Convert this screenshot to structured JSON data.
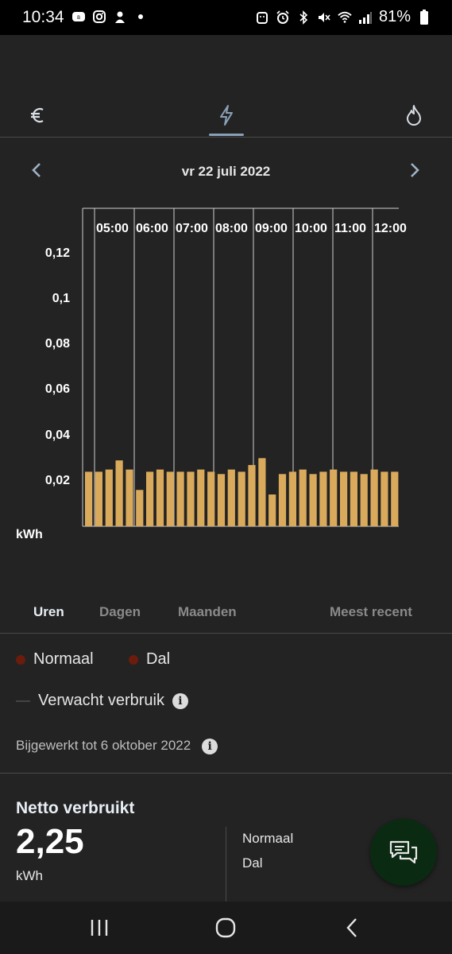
{
  "status_bar": {
    "time": "10:34",
    "battery": "81%",
    "left_icons": [
      "rcs-icon",
      "instagram-icon",
      "mascot-icon",
      "dot-icon"
    ],
    "right_icons": [
      "android-icon",
      "alarm-icon",
      "bluetooth-icon",
      "mute-icon",
      "wifi-icon",
      "signal-icon",
      "battery-icon"
    ]
  },
  "tabs": [
    {
      "name": "euro-icon",
      "active": false
    },
    {
      "name": "lightning-icon",
      "active": true
    },
    {
      "name": "flame-icon",
      "active": false
    }
  ],
  "date": {
    "title": "vr 22 juli 2022"
  },
  "chart_data": {
    "type": "bar",
    "title": "",
    "xlabel": "",
    "ylabel": "kWh",
    "ylim": [
      0,
      0.14
    ],
    "y_ticks": [
      "0,02",
      "0,04",
      "0,06",
      "0,08",
      "0,1",
      "0,12"
    ],
    "x_tick_labels": [
      "05:00",
      "06:00",
      "07:00",
      "08:00",
      "09:00",
      "10:00",
      "11:00",
      "12:00"
    ],
    "values": [
      0.024,
      0.024,
      0.025,
      0.029,
      0.025,
      0.016,
      0.024,
      0.025,
      0.024,
      0.024,
      0.024,
      0.025,
      0.024,
      0.023,
      0.025,
      0.024,
      0.027,
      0.03,
      0.014,
      0.023,
      0.024,
      0.025,
      0.023,
      0.024,
      0.025,
      0.024,
      0.024,
      0.023,
      0.025,
      0.024,
      0.024
    ],
    "bar_color": "#d9aa5c"
  },
  "periods": {
    "uren": "Uren",
    "dagen": "Dagen",
    "maanden": "Maanden",
    "meest_recent": "Meest recent"
  },
  "legend": {
    "normaal": "Normaal",
    "dal": "Dal",
    "verwacht": "Verwacht verbruik"
  },
  "updated": "Bijgewerkt tot 6 oktober 2022",
  "netto": {
    "title": "Netto verbruikt",
    "value": "2,25",
    "unit": "kWh",
    "normaal_label": "Normaal",
    "dal_label": "Dal"
  },
  "colors": {
    "background": "#232323",
    "bar": "#d9aa5c",
    "legend_dot": "#6b1c0d",
    "chat_fab": "#0b2a12"
  }
}
